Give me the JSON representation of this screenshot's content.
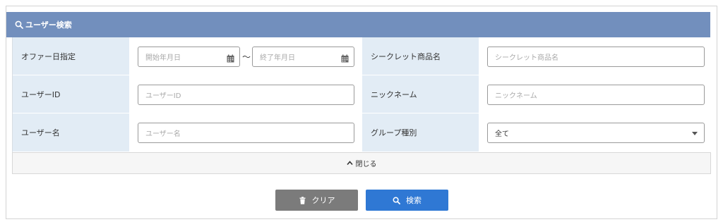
{
  "panel": {
    "title": "ユーザー検索",
    "header_color": "#728fbd"
  },
  "fields": {
    "offer_date": {
      "label": "オファー日指定",
      "start_placeholder": "開始年月日",
      "end_placeholder": "終了年月日",
      "separator": "～"
    },
    "secret_product": {
      "label": "シークレット商品名",
      "placeholder": "シークレット商品名"
    },
    "user_id": {
      "label": "ユーザーID",
      "placeholder": "ユーザーID"
    },
    "nickname": {
      "label": "ニックネーム",
      "placeholder": "ニックネーム"
    },
    "user_name": {
      "label": "ユーザー名",
      "placeholder": "ユーザー名"
    },
    "group_type": {
      "label": "グループ種別",
      "selected": "全て"
    }
  },
  "collapse": {
    "label": "閉じる"
  },
  "buttons": {
    "clear": {
      "label": "クリア",
      "color": "#7b7b7b"
    },
    "search": {
      "label": "検索",
      "color": "#2f78d4"
    }
  },
  "icons": {
    "header": "search-icon",
    "date": "calendar-icon",
    "collapse": "chevron-up-icon",
    "clear": "trash-icon",
    "search": "search-icon"
  }
}
